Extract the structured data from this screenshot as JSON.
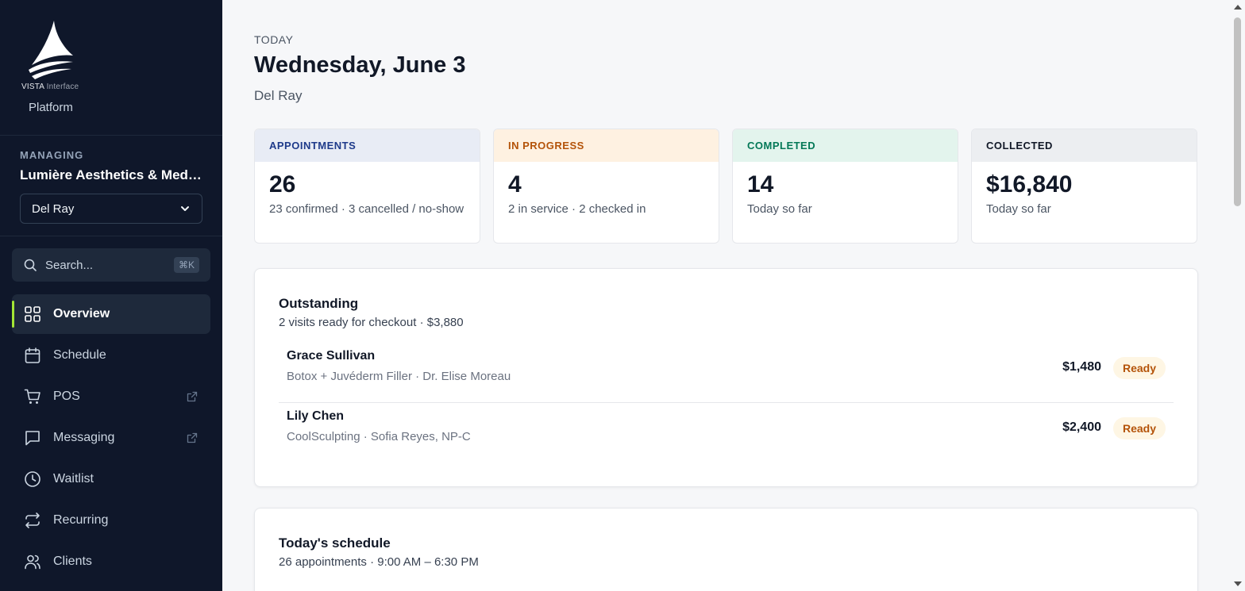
{
  "brand": {
    "logo_text_bold": "VISTA",
    "logo_text_light": "Interface",
    "platform": "Platform"
  },
  "managing": {
    "label": "MANAGING",
    "org_name": "Lumière Aesthetics & Med…",
    "location": "Del Ray"
  },
  "search": {
    "placeholder": "Search...",
    "shortcut": "⌘K"
  },
  "nav": [
    {
      "label": "Overview",
      "icon": "grid-icon",
      "active": true
    },
    {
      "label": "Schedule",
      "icon": "calendar-icon"
    },
    {
      "label": "POS",
      "icon": "cart-icon",
      "external": true
    },
    {
      "label": "Messaging",
      "icon": "message-icon",
      "external": true
    },
    {
      "label": "Waitlist",
      "icon": "clock-icon"
    },
    {
      "label": "Recurring",
      "icon": "repeat-icon"
    },
    {
      "label": "Clients",
      "icon": "users-icon"
    }
  ],
  "header": {
    "eyebrow": "TODAY",
    "title": "Wednesday, June 3",
    "location": "Del Ray"
  },
  "stats": [
    {
      "label": "APPOINTMENTS",
      "value": "26",
      "desc": "23 confirmed · 3 cancelled / no-show",
      "head_bg": "#e8ecf5",
      "head_color": "#1e3a8a"
    },
    {
      "label": "IN PROGRESS",
      "value": "4",
      "desc": "2 in service · 2 checked in",
      "head_bg": "#fef1e1",
      "head_color": "#b45309"
    },
    {
      "label": "COMPLETED",
      "value": "14",
      "desc": "Today so far",
      "head_bg": "#e3f4ed",
      "head_color": "#047857"
    },
    {
      "label": "COLLECTED",
      "value": "$16,840",
      "desc": "Today so far",
      "head_bg": "#eceef1",
      "head_color": "#111827"
    }
  ],
  "outstanding": {
    "title": "Outstanding",
    "subtitle": "2 visits ready for checkout · $3,880",
    "rows": [
      {
        "name": "Grace Sullivan",
        "detail": "Botox + Juvéderm Filler · Dr. Elise Moreau",
        "amount": "$1,480",
        "status": "Ready"
      },
      {
        "name": "Lily Chen",
        "detail": "CoolSculpting · Sofia Reyes, NP-C",
        "amount": "$2,400",
        "status": "Ready"
      }
    ]
  },
  "schedule": {
    "title": "Today's schedule",
    "subtitle": "26 appointments · 9:00 AM – 6:30 PM"
  },
  "colors": {
    "sidebar_bg": "#0f172a",
    "accent": "#a3e635",
    "badge_bg": "#fef6e4",
    "badge_text": "#b45309"
  }
}
